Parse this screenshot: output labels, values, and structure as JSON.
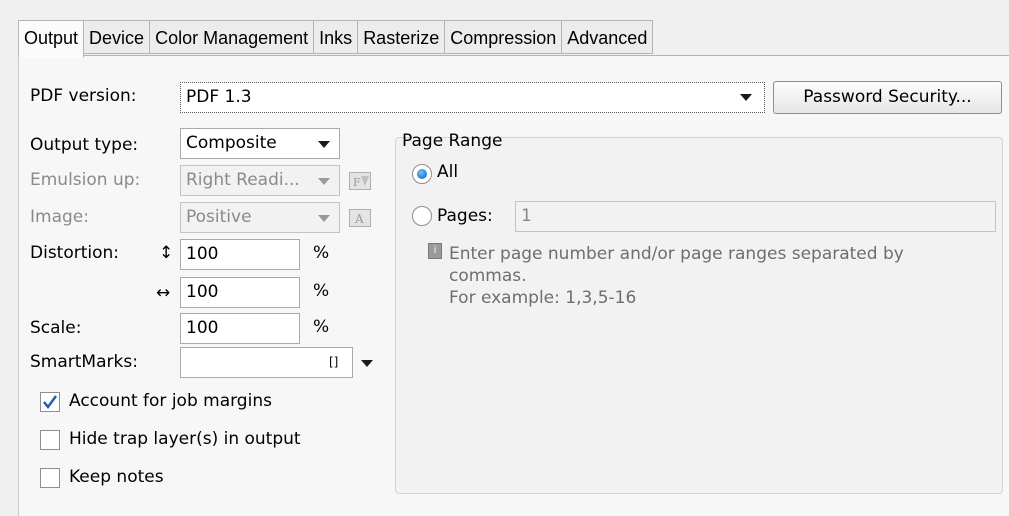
{
  "tabs": [
    {
      "label": "Output"
    },
    {
      "label": "Device"
    },
    {
      "label": "Color Management"
    },
    {
      "label": "Inks"
    },
    {
      "label": "Rasterize"
    },
    {
      "label": "Compression"
    },
    {
      "label": "Advanced"
    }
  ],
  "pdf_version": {
    "label": "PDF version:",
    "value": "PDF 1.3"
  },
  "password_button": "Password Security...",
  "output_type": {
    "label": "Output type:",
    "value": "Composite"
  },
  "emulsion": {
    "label": "Emulsion up:",
    "value": "Right Readi..."
  },
  "image": {
    "label": "Image:",
    "value": "Positive"
  },
  "distortion": {
    "label": "Distortion:",
    "vertical_symbol": "↕",
    "horizontal_symbol": "↔",
    "vertical": "100",
    "horizontal": "100",
    "unit": "%"
  },
  "scale": {
    "label": "Scale:",
    "value": "100",
    "unit": "%"
  },
  "smartmarks": {
    "label": "SmartMarks:",
    "value": "",
    "bracket": "[]"
  },
  "checkboxes": [
    {
      "label": "Account for job margins",
      "checked": true
    },
    {
      "label": "Hide trap layer(s) in output",
      "checked": false
    },
    {
      "label": "Keep notes",
      "checked": false
    }
  ],
  "page_range": {
    "title": "Page Range",
    "all_label": "All",
    "pages_label": "Pages:",
    "pages_value": "1",
    "selected": "All",
    "info_line1": "Enter page number and/or page ranges separated by",
    "info_line2": "commas.",
    "info_line3": "For example: 1,3,5-16"
  },
  "colors": {
    "radio_selected": "#0a5fb0",
    "check_mark": "#1f5fb0"
  }
}
